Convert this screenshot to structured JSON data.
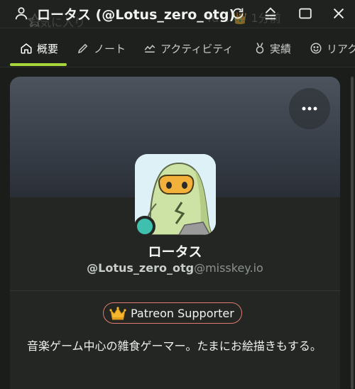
{
  "titlebar": {
    "title": "ロータス (@Lotus_zero_otg)",
    "ghost_left": "お気に入り",
    "ghost_right": "Yu... 👑 1分前"
  },
  "tabs": [
    {
      "label": "概要",
      "icon": "home-icon",
      "active": true
    },
    {
      "label": "ノート",
      "icon": "pencil-icon",
      "active": false
    },
    {
      "label": "アクティビティ",
      "icon": "activity-icon",
      "active": false
    },
    {
      "label": "実績",
      "icon": "medal-icon",
      "active": false
    },
    {
      "label": "リアク",
      "icon": "emoji-icon",
      "active": false
    }
  ],
  "profile": {
    "display_name": "ロータス",
    "username": "@Lotus_zero_otg",
    "host": "@misskey.io",
    "role": "Patreon Supporter",
    "bio": "音楽ゲーム中心の雑食ゲーマー。たまにお絵描きもする。"
  },
  "colors": {
    "accent": "#a7d63a",
    "role_border": "#e07b6f",
    "online": "#3fbfae"
  }
}
